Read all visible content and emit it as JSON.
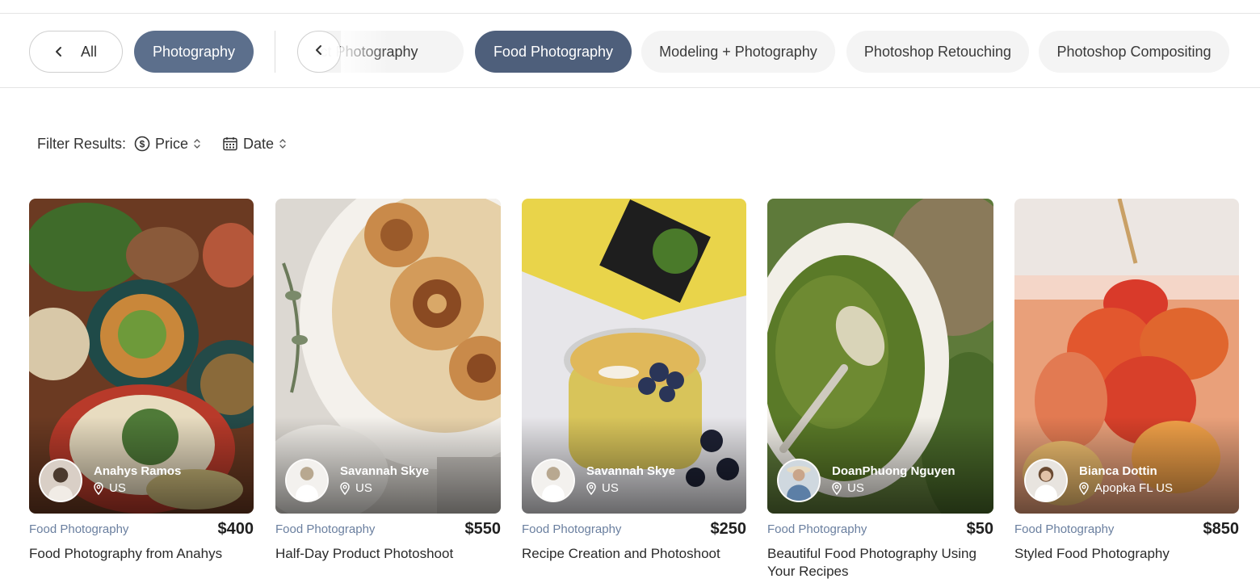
{
  "nav": {
    "back_label": "All",
    "parent_category": "Photography",
    "subcategories": [
      {
        "label": "Product Photography",
        "active": false
      },
      {
        "label": "Food Photography",
        "active": true
      },
      {
        "label": "Modeling + Photography",
        "active": false
      },
      {
        "label": "Photoshop Retouching",
        "active": false
      },
      {
        "label": "Photoshop Compositing",
        "active": false
      }
    ]
  },
  "filters": {
    "label": "Filter Results:",
    "price": "Price",
    "date": "Date"
  },
  "colors": {
    "parent_pill": "#5c6f8c",
    "active_chip": "#4e5f7b",
    "category_link": "#6a7f9f"
  },
  "listings": [
    {
      "seller": "Anahys Ramos",
      "location": "US",
      "category": "Food Photography",
      "price": "$400",
      "title": "Food Photography from Anahys"
    },
    {
      "seller": "Savannah Skye",
      "location": "US",
      "category": "Food Photography",
      "price": "$550",
      "title": "Half-Day Product Photoshoot"
    },
    {
      "seller": "Savannah Skye",
      "location": "US",
      "category": "Food Photography",
      "price": "$250",
      "title": "Recipe Creation and Photoshoot"
    },
    {
      "seller": "DoanPhuong Nguyen",
      "location": "US",
      "category": "Food Photography",
      "price": "$50",
      "title": "Beautiful Food Photography Using Your Recipes"
    },
    {
      "seller": "Bianca Dottin",
      "location": "Apopka FL US",
      "category": "Food Photography",
      "price": "$850",
      "title": "Styled Food Photography"
    }
  ]
}
